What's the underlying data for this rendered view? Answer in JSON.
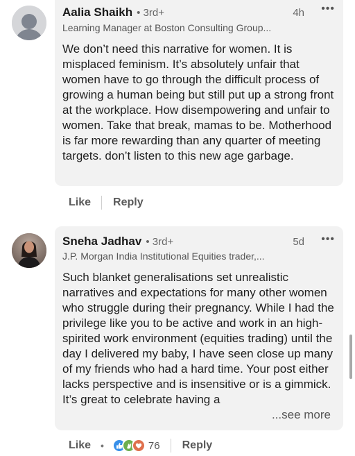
{
  "comments": [
    {
      "author": "Aalia Shaikh",
      "degree": "• 3rd+",
      "time": "4h",
      "more_glyph": "•••",
      "headline": "Learning Manager at Boston Consulting Group...",
      "body": "We don’t need this narrative for women. It is misplaced feminism. It’s absolutely unfair that women have to go through the difficult process of growing a human being but still put up a strong front at the workplace. How disempowering and unfair to women. Take that break, mamas to be. Motherhood is far more rewarding than any quarter of meeting targets. don’t listen to this new age garbage.",
      "like_label": "Like",
      "reply_label": "Reply"
    },
    {
      "author": "Sneha Jadhav",
      "degree": "• 3rd+",
      "time": "5d",
      "more_glyph": "•••",
      "headline": "J.P. Morgan India Institutional Equities trader,...",
      "body": "Such blanket generalisations set unrealistic narratives and expectations for many other women who struggle during their pregnancy. While I had the privilege like you to be active and work in an high-spirited work environment (equities trading) until the day I delivered my baby, I have seen close up many of my friends who had a hard time. Your post either lacks perspective and is insensitive or is a gimmick. It’s great to celebrate having a",
      "see_more": "...see more",
      "like_label": "Like",
      "dot": "•",
      "reaction_count": "76",
      "reply_label": "Reply"
    }
  ],
  "colors": {
    "bubble": "#f2f2f2",
    "like_reaction": "#378fe9",
    "clap_reaction": "#6dae4f",
    "love_reaction": "#df704d"
  },
  "icons": [
    "default-avatar-icon",
    "profile-photo",
    "like-reaction-icon",
    "celebrate-reaction-icon",
    "love-reaction-icon",
    "more-options-icon"
  ]
}
